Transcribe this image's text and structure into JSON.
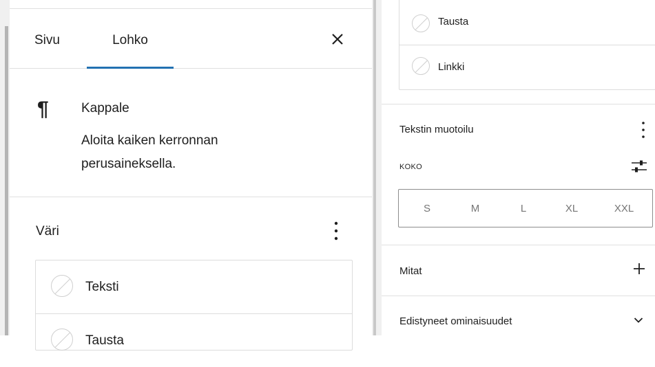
{
  "tabs": {
    "page": "Sivu",
    "block": "Lohko"
  },
  "block": {
    "icon_glyph": "¶",
    "title": "Kappale",
    "description": "Aloita kaiken kerronnan perusaineksella."
  },
  "color_section": {
    "title": "Väri",
    "items": [
      {
        "label": "Teksti"
      },
      {
        "label": "Tausta"
      },
      {
        "label": "Linkki"
      }
    ]
  },
  "typography": {
    "title": "Tekstin muotoilu",
    "size_label": "KOKO",
    "sizes": [
      "S",
      "M",
      "L",
      "XL",
      "XXL"
    ]
  },
  "dimensions": {
    "title": "Mitat"
  },
  "advanced": {
    "title": "Edistyneet ominaisuudet"
  },
  "colors": {
    "accent": "#2271b1",
    "border": "#e0e0e0",
    "text": "#1e1e1e",
    "muted": "#757575"
  },
  "icons": {
    "close": "close-icon",
    "more": "more-vertical-icon",
    "swatch": "empty-swatch-icon",
    "sliders": "sliders-icon",
    "plus": "plus-icon",
    "chevron": "chevron-down-icon"
  }
}
